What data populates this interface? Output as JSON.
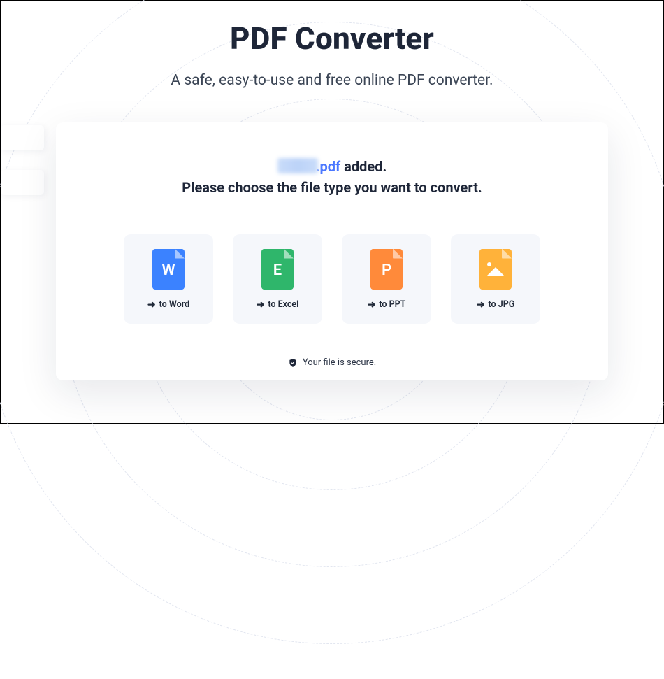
{
  "header": {
    "title": "PDF Converter",
    "subtitle": "A safe, easy-to-use and free online PDF converter."
  },
  "upload_status": {
    "file_ext": ".pdf",
    "added_suffix": " added.",
    "instruction": "Please choose the file type you want to convert."
  },
  "options": [
    {
      "id": "word",
      "letter": "W",
      "icon": "word-file-icon",
      "label": "to Word"
    },
    {
      "id": "excel",
      "letter": "E",
      "icon": "excel-file-icon",
      "label": "to Excel"
    },
    {
      "id": "ppt",
      "letter": "P",
      "icon": "ppt-file-icon",
      "label": "to PPT"
    },
    {
      "id": "jpg",
      "letter": "",
      "icon": "jpg-file-icon",
      "label": "to JPG"
    }
  ],
  "secure_note": "Your file is secure.",
  "colors": {
    "word": "#3b82ff",
    "excel": "#2fb66b",
    "ppt": "#ff8a3a",
    "jpg": "#ffb23a",
    "accent": "#4a77ff"
  }
}
